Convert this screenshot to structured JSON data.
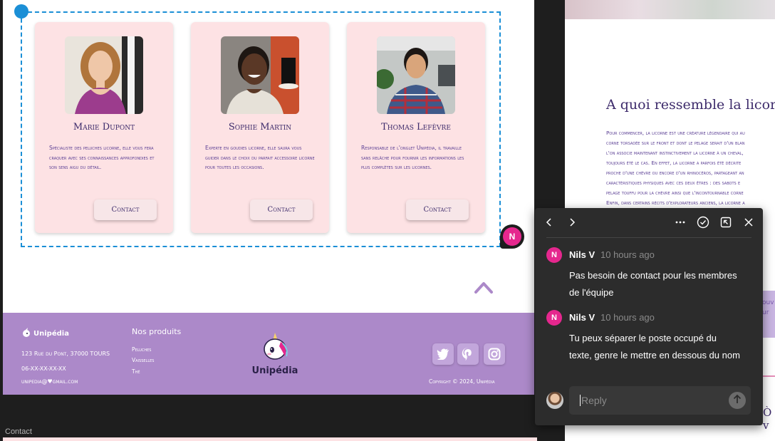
{
  "team": {
    "cards": [
      {
        "name": "Marie Dupont",
        "description": "Spécialiste des peluches licorne, elle vous fera craquer avec ses connaissances approfondies et son sens aigu du détail.",
        "contact_label": "Contact"
      },
      {
        "name": "Sophie Martin",
        "description": "Experte en goudies licorne, elle saura vous guider dans le choix du parfait accessoire licorne pour toutes les occasions.",
        "contact_label": "Contact"
      },
      {
        "name": "Thomas Lefèvre",
        "description": "Responsable de l'onglet Unipédia, il travaille sans relâche pour fournir les informations les plus complètes sur les licornes.",
        "contact_label": "Contact"
      }
    ],
    "comment_pin_initial": "N"
  },
  "footer": {
    "logo_text": "Unipédia",
    "address": "123 Rue du Pont, 37000 TOURS",
    "phone": "06-XX-XX-XX-XX",
    "email": "unipedia@♥gmail.com",
    "products_title": "Nos produits",
    "products": [
      "Peluches",
      "Vaisselles",
      "Thé"
    ],
    "brand_name": "Unipédia",
    "copyright": "Copyright © 2024, Unipédia",
    "social_icons": [
      "twitter-icon",
      "pinterest-icon",
      "instagram-icon"
    ],
    "background_color": "#ac89c9"
  },
  "canvas": {
    "frame_label": "Contact"
  },
  "article": {
    "title": "A quoi ressemble la licorne?",
    "lines": [
      "Pour commencer, la licorne est une créature légendaire qui au",
      "corne torsadée sur le front et dont le pelage serait d'un blan",
      "l'on associe maintenant instinctivement la licorne à un cheval,",
      "toujours été le cas. En effet, la licorne a parfois été décrite",
      "proche d'une chèvre ou encore d'un rhinocéros, partageant an",
      "caractéristiques physiques avec ces deux êtres : des sabots e",
      "pelage touffu pour la chèvre ainsi que l'incontournable corne",
      "Enfin, dans certains récits d'explorateurs anciens, la licorne a"
    ],
    "side_text": "ouv\nur",
    "edge_text": "Ò v"
  },
  "comments": {
    "items": [
      {
        "initial": "N",
        "author": "Nils V",
        "time": "10 hours ago",
        "text": "Pas besoin de contact pour les membres de l'équipe"
      },
      {
        "initial": "N",
        "author": "Nils V",
        "time": "10 hours ago",
        "text": "Tu peux séparer le poste occupé du texte, genre le mettre en dessous du nom"
      }
    ],
    "reply_placeholder": "Reply",
    "accent_color": "#e5278e"
  }
}
